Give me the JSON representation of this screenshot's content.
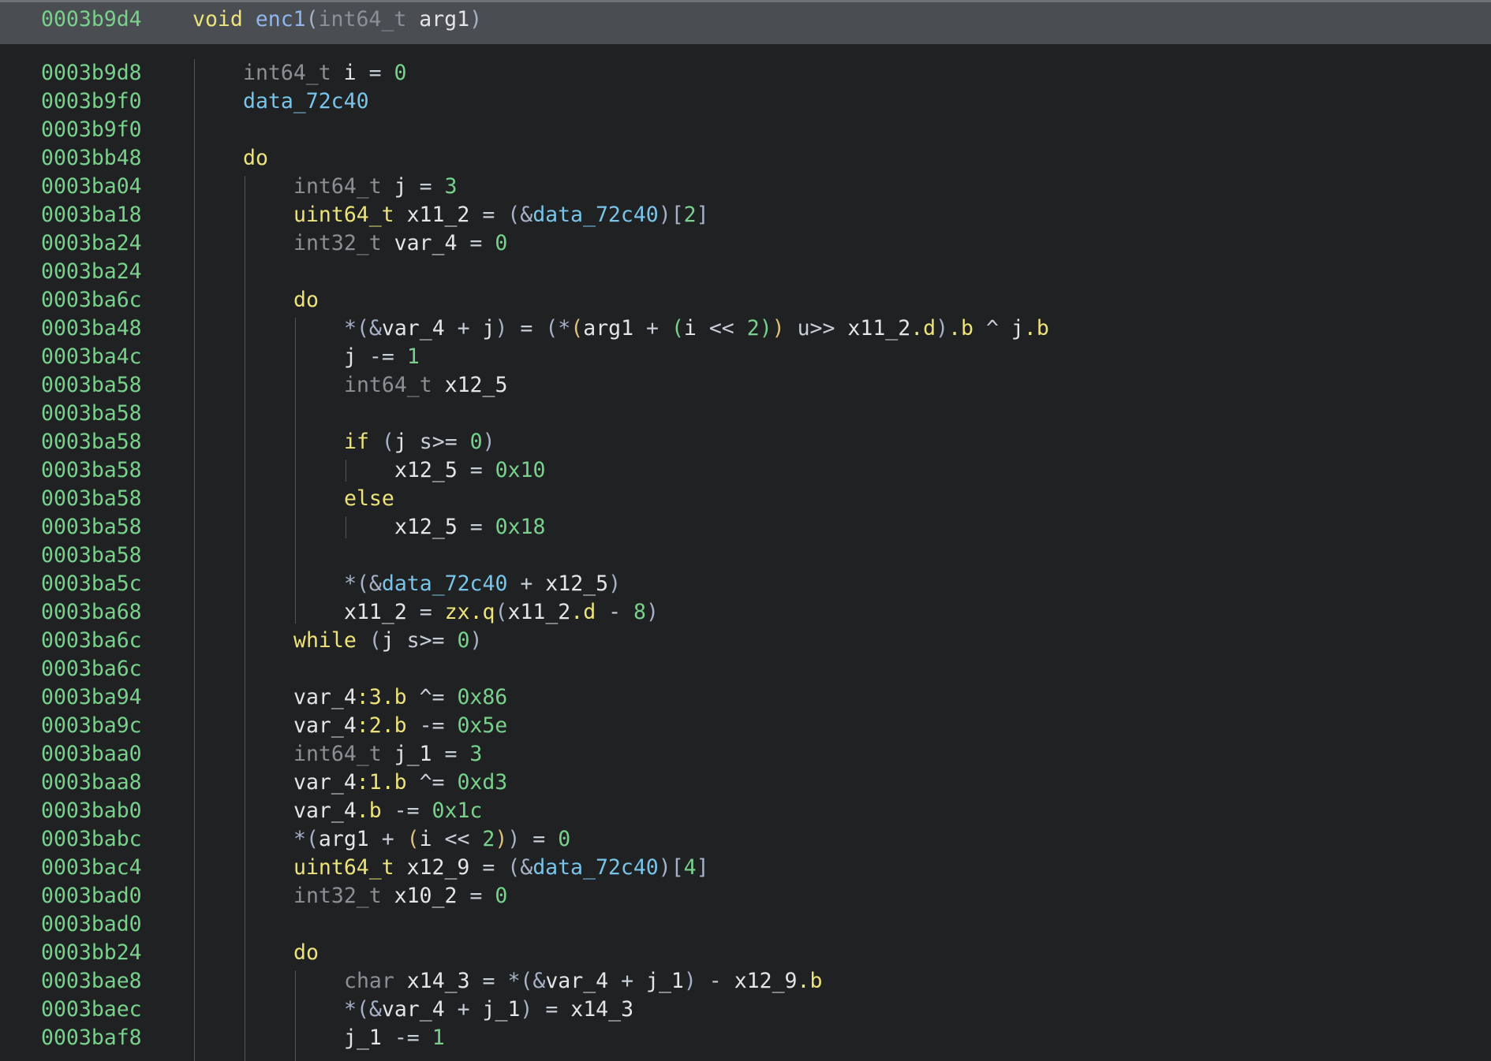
{
  "header": {
    "address": "0003b9d4",
    "signature": [
      {
        "text": "void",
        "cls": "t-kw"
      },
      {
        "text": " ",
        "cls": "t-var"
      },
      {
        "text": "enc1",
        "cls": "t-fn"
      },
      {
        "text": "(",
        "cls": "t-paren"
      },
      {
        "text": "int64_t",
        "cls": "t-type"
      },
      {
        "text": " arg1",
        "cls": "t-var"
      },
      {
        "text": ")",
        "cls": "t-paren"
      }
    ]
  },
  "lines": [
    {
      "addr": "0003b9d8",
      "indent": 1,
      "tokens": [
        {
          "text": "int64_t",
          "cls": "t-type"
        },
        {
          "text": " i ",
          "cls": "t-var"
        },
        {
          "text": "=",
          "cls": "t-op"
        },
        {
          "text": " ",
          "cls": "t-var"
        },
        {
          "text": "0",
          "cls": "t-num"
        }
      ]
    },
    {
      "addr": "0003b9f0",
      "indent": 1,
      "tokens": [
        {
          "text": "data_72c40",
          "cls": "t-data"
        }
      ]
    },
    {
      "addr": "0003b9f0",
      "indent": 1,
      "tokens": []
    },
    {
      "addr": "0003bb48",
      "indent": 1,
      "tokens": [
        {
          "text": "do",
          "cls": "t-kw"
        }
      ]
    },
    {
      "addr": "0003ba04",
      "indent": 2,
      "tokens": [
        {
          "text": "int64_t",
          "cls": "t-type"
        },
        {
          "text": " j ",
          "cls": "t-var"
        },
        {
          "text": "=",
          "cls": "t-op"
        },
        {
          "text": " ",
          "cls": "t-var"
        },
        {
          "text": "3",
          "cls": "t-num"
        }
      ]
    },
    {
      "addr": "0003ba18",
      "indent": 2,
      "tokens": [
        {
          "text": "uint64_t",
          "cls": "t-ptype"
        },
        {
          "text": " x11_2 ",
          "cls": "t-var"
        },
        {
          "text": "=",
          "cls": "t-op"
        },
        {
          "text": " ",
          "cls": "t-var"
        },
        {
          "text": "(&",
          "cls": "t-paren"
        },
        {
          "text": "data_72c40",
          "cls": "t-data"
        },
        {
          "text": ")[",
          "cls": "t-paren"
        },
        {
          "text": "2",
          "cls": "t-num"
        },
        {
          "text": "]",
          "cls": "t-paren"
        }
      ]
    },
    {
      "addr": "0003ba24",
      "indent": 2,
      "tokens": [
        {
          "text": "int32_t",
          "cls": "t-type"
        },
        {
          "text": " var_4 ",
          "cls": "t-var"
        },
        {
          "text": "=",
          "cls": "t-op"
        },
        {
          "text": " ",
          "cls": "t-var"
        },
        {
          "text": "0",
          "cls": "t-num"
        }
      ]
    },
    {
      "addr": "0003ba24",
      "indent": 2,
      "tokens": []
    },
    {
      "addr": "0003ba6c",
      "indent": 2,
      "tokens": [
        {
          "text": "do",
          "cls": "t-kw"
        }
      ]
    },
    {
      "addr": "0003ba48",
      "indent": 3,
      "tokens": [
        {
          "text": "*(&",
          "cls": "t-paren"
        },
        {
          "text": "var_4 ",
          "cls": "t-var"
        },
        {
          "text": "+",
          "cls": "t-op"
        },
        {
          "text": " j",
          "cls": "t-var"
        },
        {
          "text": ")",
          "cls": "t-paren"
        },
        {
          "text": " = ",
          "cls": "t-op"
        },
        {
          "text": "(*",
          "cls": "t-paren"
        },
        {
          "text": "(",
          "cls": "t-paren2"
        },
        {
          "text": "arg1 ",
          "cls": "t-var"
        },
        {
          "text": "+",
          "cls": "t-op"
        },
        {
          "text": " ",
          "cls": "t-var"
        },
        {
          "text": "(",
          "cls": "t-paren3"
        },
        {
          "text": "i ",
          "cls": "t-var"
        },
        {
          "text": "<<",
          "cls": "t-op"
        },
        {
          "text": " ",
          "cls": "t-var"
        },
        {
          "text": "2",
          "cls": "t-num"
        },
        {
          "text": ")",
          "cls": "t-paren3"
        },
        {
          "text": ")",
          "cls": "t-paren2"
        },
        {
          "text": " u>> ",
          "cls": "t-op"
        },
        {
          "text": "x11_2",
          "cls": "t-var"
        },
        {
          "text": ".d",
          "cls": "t-field"
        },
        {
          "text": ")",
          "cls": "t-paren"
        },
        {
          "text": ".b",
          "cls": "t-field"
        },
        {
          "text": " ^ ",
          "cls": "t-op"
        },
        {
          "text": "j",
          "cls": "t-var"
        },
        {
          "text": ".b",
          "cls": "t-field"
        }
      ]
    },
    {
      "addr": "0003ba4c",
      "indent": 3,
      "tokens": [
        {
          "text": "j ",
          "cls": "t-var"
        },
        {
          "text": "-=",
          "cls": "t-op"
        },
        {
          "text": " ",
          "cls": "t-var"
        },
        {
          "text": "1",
          "cls": "t-num"
        }
      ]
    },
    {
      "addr": "0003ba58",
      "indent": 3,
      "tokens": [
        {
          "text": "int64_t",
          "cls": "t-type"
        },
        {
          "text": " x12_5",
          "cls": "t-var"
        }
      ]
    },
    {
      "addr": "0003ba58",
      "indent": 3,
      "tokens": []
    },
    {
      "addr": "0003ba58",
      "indent": 3,
      "tokens": [
        {
          "text": "if",
          "cls": "t-kw"
        },
        {
          "text": " ",
          "cls": "t-var"
        },
        {
          "text": "(",
          "cls": "t-paren"
        },
        {
          "text": "j ",
          "cls": "t-var"
        },
        {
          "text": "s>=",
          "cls": "t-op"
        },
        {
          "text": " ",
          "cls": "t-var"
        },
        {
          "text": "0",
          "cls": "t-num"
        },
        {
          "text": ")",
          "cls": "t-paren"
        }
      ]
    },
    {
      "addr": "0003ba58",
      "indent": 4,
      "tokens": [
        {
          "text": "x12_5 ",
          "cls": "t-var"
        },
        {
          "text": "=",
          "cls": "t-op"
        },
        {
          "text": " ",
          "cls": "t-var"
        },
        {
          "text": "0x10",
          "cls": "t-num"
        }
      ]
    },
    {
      "addr": "0003ba58",
      "indent": 3,
      "tokens": [
        {
          "text": "else",
          "cls": "t-kw"
        }
      ]
    },
    {
      "addr": "0003ba58",
      "indent": 4,
      "tokens": [
        {
          "text": "x12_5 ",
          "cls": "t-var"
        },
        {
          "text": "=",
          "cls": "t-op"
        },
        {
          "text": " ",
          "cls": "t-var"
        },
        {
          "text": "0x18",
          "cls": "t-num"
        }
      ]
    },
    {
      "addr": "0003ba58",
      "indent": 3,
      "tokens": []
    },
    {
      "addr": "0003ba5c",
      "indent": 3,
      "tokens": [
        {
          "text": "*(&",
          "cls": "t-paren"
        },
        {
          "text": "data_72c40",
          "cls": "t-data"
        },
        {
          "text": " + ",
          "cls": "t-op"
        },
        {
          "text": "x12_5",
          "cls": "t-var"
        },
        {
          "text": ")",
          "cls": "t-paren"
        }
      ]
    },
    {
      "addr": "0003ba68",
      "indent": 3,
      "tokens": [
        {
          "text": "x11_2 ",
          "cls": "t-var"
        },
        {
          "text": "=",
          "cls": "t-op"
        },
        {
          "text": " ",
          "cls": "t-var"
        },
        {
          "text": "zx.q",
          "cls": "t-field"
        },
        {
          "text": "(",
          "cls": "t-paren"
        },
        {
          "text": "x11_2",
          "cls": "t-var"
        },
        {
          "text": ".d",
          "cls": "t-field"
        },
        {
          "text": " - ",
          "cls": "t-op"
        },
        {
          "text": "8",
          "cls": "t-num"
        },
        {
          "text": ")",
          "cls": "t-paren"
        }
      ]
    },
    {
      "addr": "0003ba6c",
      "indent": 2,
      "tokens": [
        {
          "text": "while",
          "cls": "t-kw"
        },
        {
          "text": " ",
          "cls": "t-var"
        },
        {
          "text": "(",
          "cls": "t-paren"
        },
        {
          "text": "j ",
          "cls": "t-var"
        },
        {
          "text": "s>=",
          "cls": "t-op"
        },
        {
          "text": " ",
          "cls": "t-var"
        },
        {
          "text": "0",
          "cls": "t-num"
        },
        {
          "text": ")",
          "cls": "t-paren"
        }
      ]
    },
    {
      "addr": "0003ba6c",
      "indent": 2,
      "tokens": []
    },
    {
      "addr": "0003ba94",
      "indent": 2,
      "tokens": [
        {
          "text": "var_4",
          "cls": "t-var"
        },
        {
          "text": ":3.b",
          "cls": "t-field"
        },
        {
          "text": " ^= ",
          "cls": "t-op"
        },
        {
          "text": "0x86",
          "cls": "t-num"
        }
      ]
    },
    {
      "addr": "0003ba9c",
      "indent": 2,
      "tokens": [
        {
          "text": "var_4",
          "cls": "t-var"
        },
        {
          "text": ":2.b",
          "cls": "t-field"
        },
        {
          "text": " -= ",
          "cls": "t-op"
        },
        {
          "text": "0x5e",
          "cls": "t-num"
        }
      ]
    },
    {
      "addr": "0003baa0",
      "indent": 2,
      "tokens": [
        {
          "text": "int64_t",
          "cls": "t-type"
        },
        {
          "text": " j_1 ",
          "cls": "t-var"
        },
        {
          "text": "=",
          "cls": "t-op"
        },
        {
          "text": " ",
          "cls": "t-var"
        },
        {
          "text": "3",
          "cls": "t-num"
        }
      ]
    },
    {
      "addr": "0003baa8",
      "indent": 2,
      "tokens": [
        {
          "text": "var_4",
          "cls": "t-var"
        },
        {
          "text": ":1.b",
          "cls": "t-field"
        },
        {
          "text": " ^= ",
          "cls": "t-op"
        },
        {
          "text": "0xd3",
          "cls": "t-num"
        }
      ]
    },
    {
      "addr": "0003bab0",
      "indent": 2,
      "tokens": [
        {
          "text": "var_4",
          "cls": "t-var"
        },
        {
          "text": ".b",
          "cls": "t-field"
        },
        {
          "text": " -= ",
          "cls": "t-op"
        },
        {
          "text": "0x1c",
          "cls": "t-num"
        }
      ]
    },
    {
      "addr": "0003babc",
      "indent": 2,
      "tokens": [
        {
          "text": "*(",
          "cls": "t-paren"
        },
        {
          "text": "arg1 ",
          "cls": "t-var"
        },
        {
          "text": "+",
          "cls": "t-op"
        },
        {
          "text": " ",
          "cls": "t-var"
        },
        {
          "text": "(",
          "cls": "t-paren2"
        },
        {
          "text": "i ",
          "cls": "t-var"
        },
        {
          "text": "<<",
          "cls": "t-op"
        },
        {
          "text": " ",
          "cls": "t-var"
        },
        {
          "text": "2",
          "cls": "t-num"
        },
        {
          "text": ")",
          "cls": "t-paren2"
        },
        {
          "text": ")",
          "cls": "t-paren"
        },
        {
          "text": " = ",
          "cls": "t-op"
        },
        {
          "text": "0",
          "cls": "t-num"
        }
      ]
    },
    {
      "addr": "0003bac4",
      "indent": 2,
      "tokens": [
        {
          "text": "uint64_t",
          "cls": "t-ptype"
        },
        {
          "text": " x12_9 ",
          "cls": "t-var"
        },
        {
          "text": "=",
          "cls": "t-op"
        },
        {
          "text": " ",
          "cls": "t-var"
        },
        {
          "text": "(&",
          "cls": "t-paren"
        },
        {
          "text": "data_72c40",
          "cls": "t-data"
        },
        {
          "text": ")[",
          "cls": "t-paren"
        },
        {
          "text": "4",
          "cls": "t-num"
        },
        {
          "text": "]",
          "cls": "t-paren"
        }
      ]
    },
    {
      "addr": "0003bad0",
      "indent": 2,
      "tokens": [
        {
          "text": "int32_t",
          "cls": "t-type"
        },
        {
          "text": " x10_2 ",
          "cls": "t-var"
        },
        {
          "text": "=",
          "cls": "t-op"
        },
        {
          "text": " ",
          "cls": "t-var"
        },
        {
          "text": "0",
          "cls": "t-num"
        }
      ]
    },
    {
      "addr": "0003bad0",
      "indent": 2,
      "tokens": []
    },
    {
      "addr": "0003bb24",
      "indent": 2,
      "tokens": [
        {
          "text": "do",
          "cls": "t-kw"
        }
      ]
    },
    {
      "addr": "0003bae8",
      "indent": 3,
      "tokens": [
        {
          "text": "char",
          "cls": "t-type"
        },
        {
          "text": " x14_3 ",
          "cls": "t-var"
        },
        {
          "text": "=",
          "cls": "t-op"
        },
        {
          "text": " ",
          "cls": "t-var"
        },
        {
          "text": "*(&",
          "cls": "t-paren"
        },
        {
          "text": "var_4 ",
          "cls": "t-var"
        },
        {
          "text": "+",
          "cls": "t-op"
        },
        {
          "text": " j_1",
          "cls": "t-var"
        },
        {
          "text": ")",
          "cls": "t-paren"
        },
        {
          "text": " - ",
          "cls": "t-op"
        },
        {
          "text": "x12_9",
          "cls": "t-var"
        },
        {
          "text": ".b",
          "cls": "t-field"
        }
      ]
    },
    {
      "addr": "0003baec",
      "indent": 3,
      "tokens": [
        {
          "text": "*(&",
          "cls": "t-paren"
        },
        {
          "text": "var_4 ",
          "cls": "t-var"
        },
        {
          "text": "+",
          "cls": "t-op"
        },
        {
          "text": " j_1",
          "cls": "t-var"
        },
        {
          "text": ")",
          "cls": "t-paren"
        },
        {
          "text": " = ",
          "cls": "t-op"
        },
        {
          "text": "x14_3",
          "cls": "t-var"
        }
      ]
    },
    {
      "addr": "0003baf8",
      "indent": 3,
      "tokens": [
        {
          "text": "j_1 ",
          "cls": "t-var"
        },
        {
          "text": "-=",
          "cls": "t-op"
        },
        {
          "text": " ",
          "cls": "t-var"
        },
        {
          "text": "1",
          "cls": "t-num"
        }
      ]
    }
  ]
}
